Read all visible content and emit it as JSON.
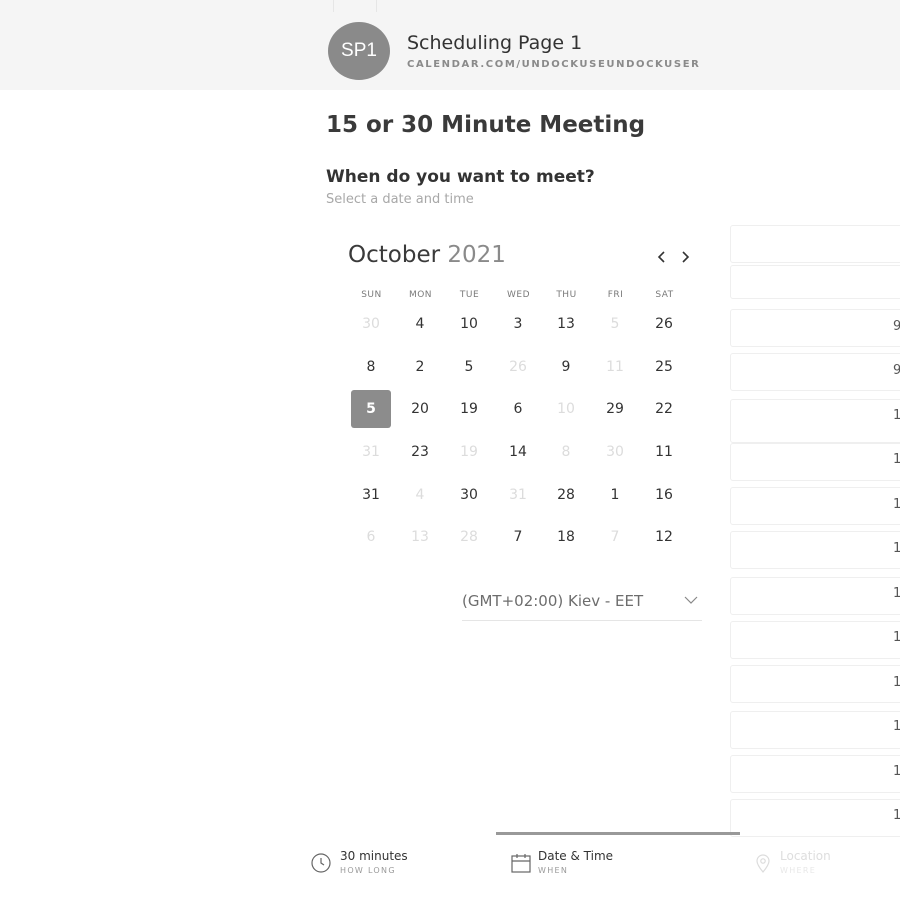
{
  "header": {
    "avatar_initials": "SP1",
    "page_name": "Scheduling Page 1",
    "page_url": "CALENDAR.COM/UNDOCKUSEUNDOCKUSER"
  },
  "meeting": {
    "title": "15 or 30 Minute Meeting",
    "question": "When do you want to meet?",
    "subtitle": "Select a date and time"
  },
  "calendar": {
    "month": "October",
    "year": "2021",
    "prev_icon": "chevron-left-icon",
    "next_icon": "chevron-right-icon",
    "weekdays": [
      "SUN",
      "MON",
      "TUE",
      "WED",
      "THU",
      "FRI",
      "SAT"
    ],
    "weeks": [
      [
        {
          "d": "30",
          "off": true
        },
        {
          "d": "4"
        },
        {
          "d": "10"
        },
        {
          "d": "3"
        },
        {
          "d": "13"
        },
        {
          "d": "5",
          "off": true
        },
        {
          "d": "26"
        }
      ],
      [
        {
          "d": "8"
        },
        {
          "d": "2"
        },
        {
          "d": "5"
        },
        {
          "d": "26",
          "off": true
        },
        {
          "d": "9"
        },
        {
          "d": "11",
          "off": true
        },
        {
          "d": "25"
        }
      ],
      [
        {
          "d": "5",
          "selected": true
        },
        {
          "d": "20"
        },
        {
          "d": "19"
        },
        {
          "d": "6"
        },
        {
          "d": "10",
          "off": true
        },
        {
          "d": "29"
        },
        {
          "d": "22"
        }
      ],
      [
        {
          "d": "31",
          "off": true
        },
        {
          "d": "23"
        },
        {
          "d": "19",
          "off": true
        },
        {
          "d": "14"
        },
        {
          "d": "8",
          "off": true
        },
        {
          "d": "30",
          "off": true
        },
        {
          "d": "11"
        }
      ],
      [
        {
          "d": "31"
        },
        {
          "d": "4",
          "off": true
        },
        {
          "d": "30"
        },
        {
          "d": "31",
          "off": true
        },
        {
          "d": "28"
        },
        {
          "d": "1"
        },
        {
          "d": "16"
        }
      ],
      [
        {
          "d": "6",
          "off": true
        },
        {
          "d": "13",
          "off": true
        },
        {
          "d": "28",
          "off": true
        },
        {
          "d": "7"
        },
        {
          "d": "18"
        },
        {
          "d": "7",
          "off": true
        },
        {
          "d": "12"
        }
      ]
    ]
  },
  "timezone": {
    "label": "(GMT+02:00) Kiev - EET",
    "icon": "chevron-down-icon"
  },
  "time_slots": [
    "9",
    "9",
    "1",
    "1",
    "1",
    "1",
    "1",
    "1",
    "1",
    "1",
    "1",
    "1"
  ],
  "steps": [
    {
      "label": "30 minutes",
      "sub": "HOW LONG",
      "icon": "clock-icon"
    },
    {
      "label": "Date & Time",
      "sub": "WHEN",
      "icon": "calendar-icon"
    },
    {
      "label": "Location",
      "sub": "WHERE",
      "icon": "location-pin-icon"
    }
  ]
}
